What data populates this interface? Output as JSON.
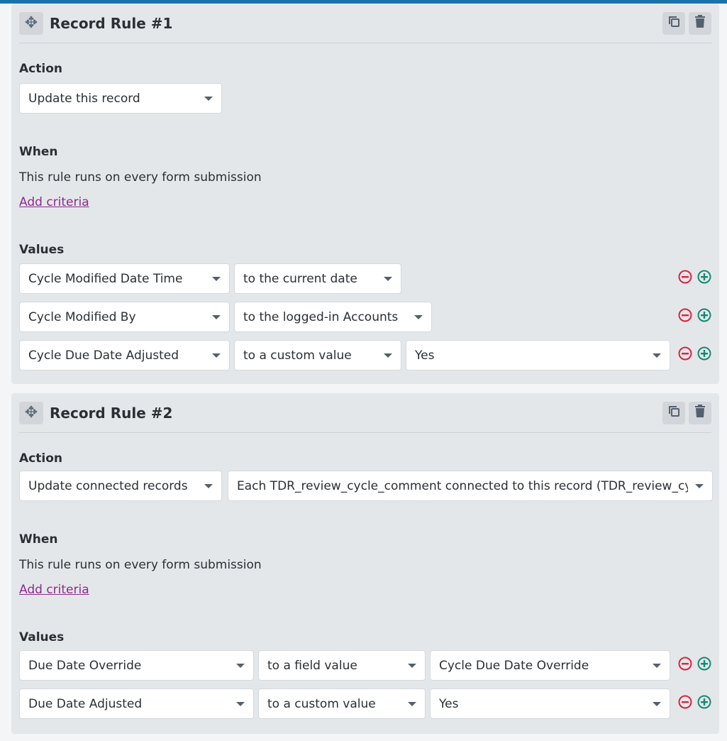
{
  "colors": {
    "accent": "#1b72a8",
    "remove": "#d7263d",
    "add": "#138a72",
    "link": "#8e2a8b"
  },
  "rules": [
    {
      "title": "Record Rule #1",
      "action_label": "Action",
      "actions": [
        "Update this record"
      ],
      "when_label": "When",
      "when_text": "This rule runs on every form submission",
      "add_criteria": "Add criteria",
      "values_label": "Values",
      "rows": [
        [
          "Cycle Modified Date Time",
          "to the current date"
        ],
        [
          "Cycle Modified By",
          "to the logged-in Accounts"
        ],
        [
          "Cycle Due Date Adjusted",
          "to a custom value",
          "Yes"
        ]
      ]
    },
    {
      "title": "Record Rule #2",
      "action_label": "Action",
      "actions": [
        "Update connected records",
        "Each TDR_review_cycle_comment connected to this record (TDR_review_cycle_comments)"
      ],
      "when_label": "When",
      "when_text": "This rule runs on every form submission",
      "add_criteria": "Add criteria",
      "values_label": "Values",
      "rows": [
        [
          "Due Date Override",
          "to a field value",
          "Cycle Due Date Override"
        ],
        [
          "Due Date Adjusted",
          "to a custom value",
          "Yes"
        ]
      ]
    }
  ]
}
